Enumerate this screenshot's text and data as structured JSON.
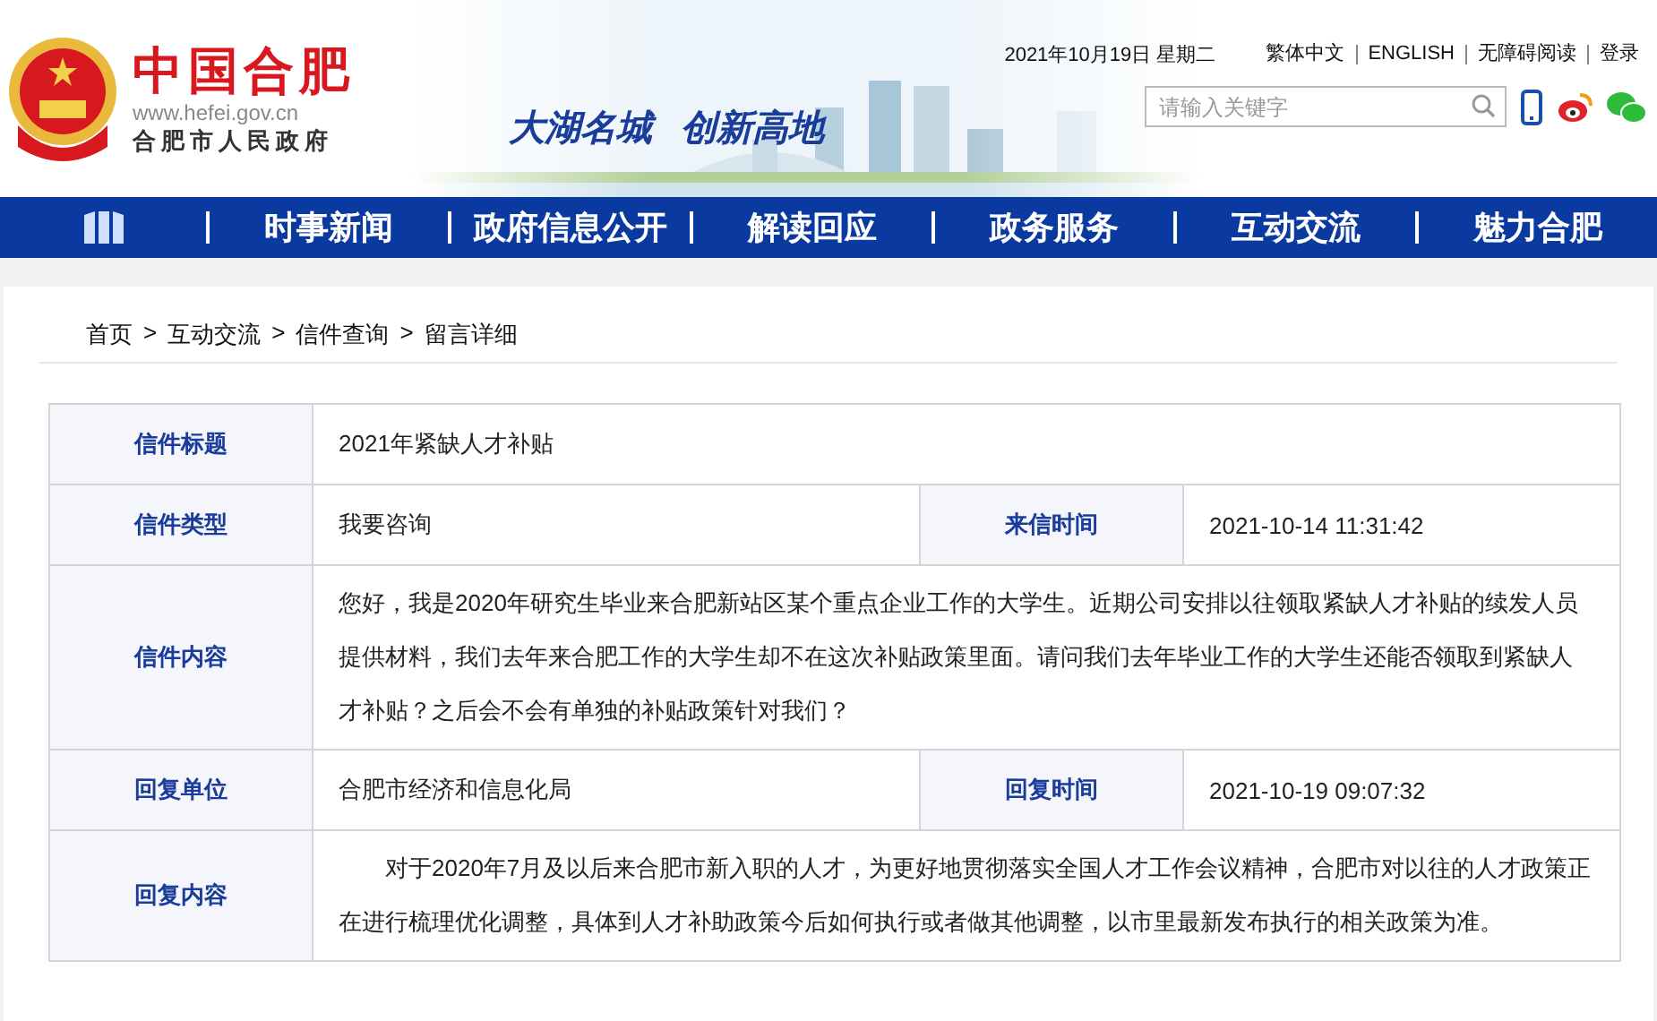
{
  "header": {
    "title": "中国合肥",
    "url": "www.hefei.gov.cn",
    "org": "合肥市人民政府",
    "slogan": [
      "大湖名城",
      "创新高地"
    ],
    "date": "2021年10月19日 星期二",
    "links": [
      "繁体中文",
      "ENGLISH",
      "无障碍阅读",
      "登录"
    ],
    "search": {
      "placeholder": "请输入关键字"
    }
  },
  "nav": [
    "时事新闻",
    "政府信息公开",
    "解读回应",
    "政务服务",
    "互动交流",
    "魅力合肥"
  ],
  "breadcrumb": [
    "首页",
    "互动交流",
    "信件查询",
    "留言详细"
  ],
  "separator": ">",
  "rows": [
    {
      "kind": "single",
      "label": "信件标题",
      "value": "2021年紧缺人才补贴"
    },
    {
      "kind": "pair",
      "label": "信件类型",
      "value": "我要咨询",
      "label2": "来信时间",
      "value2": "2021-10-14 11:31:42"
    },
    {
      "kind": "text",
      "label": "信件内容",
      "value": "您好，我是2020年研究生毕业来合肥新站区某个重点企业工作的大学生。近期公司安排以往领取紧缺人才补贴的续发人员提供材料，我们去年来合肥工作的大学生却不在这次补贴政策里面。请问我们去年毕业工作的大学生还能否领取到紧缺人才补贴？之后会不会有单独的补贴政策针对我们？"
    },
    {
      "kind": "pair",
      "label": "回复单位",
      "value": "合肥市经济和信息化局",
      "label2": "回复时间",
      "value2": "2021-10-19 09:07:32"
    },
    {
      "kind": "indented",
      "label": "回复内容",
      "value": "对于2020年7月及以后来合肥市新入职的人才，为更好地贯彻落实全国人才工作会议精神，合肥市对以往的人才政策正在进行梳理优化调整，具体到人才补助政策今后如何执行或者做其他调整，以市里最新发布执行的相关政策为准。"
    }
  ]
}
